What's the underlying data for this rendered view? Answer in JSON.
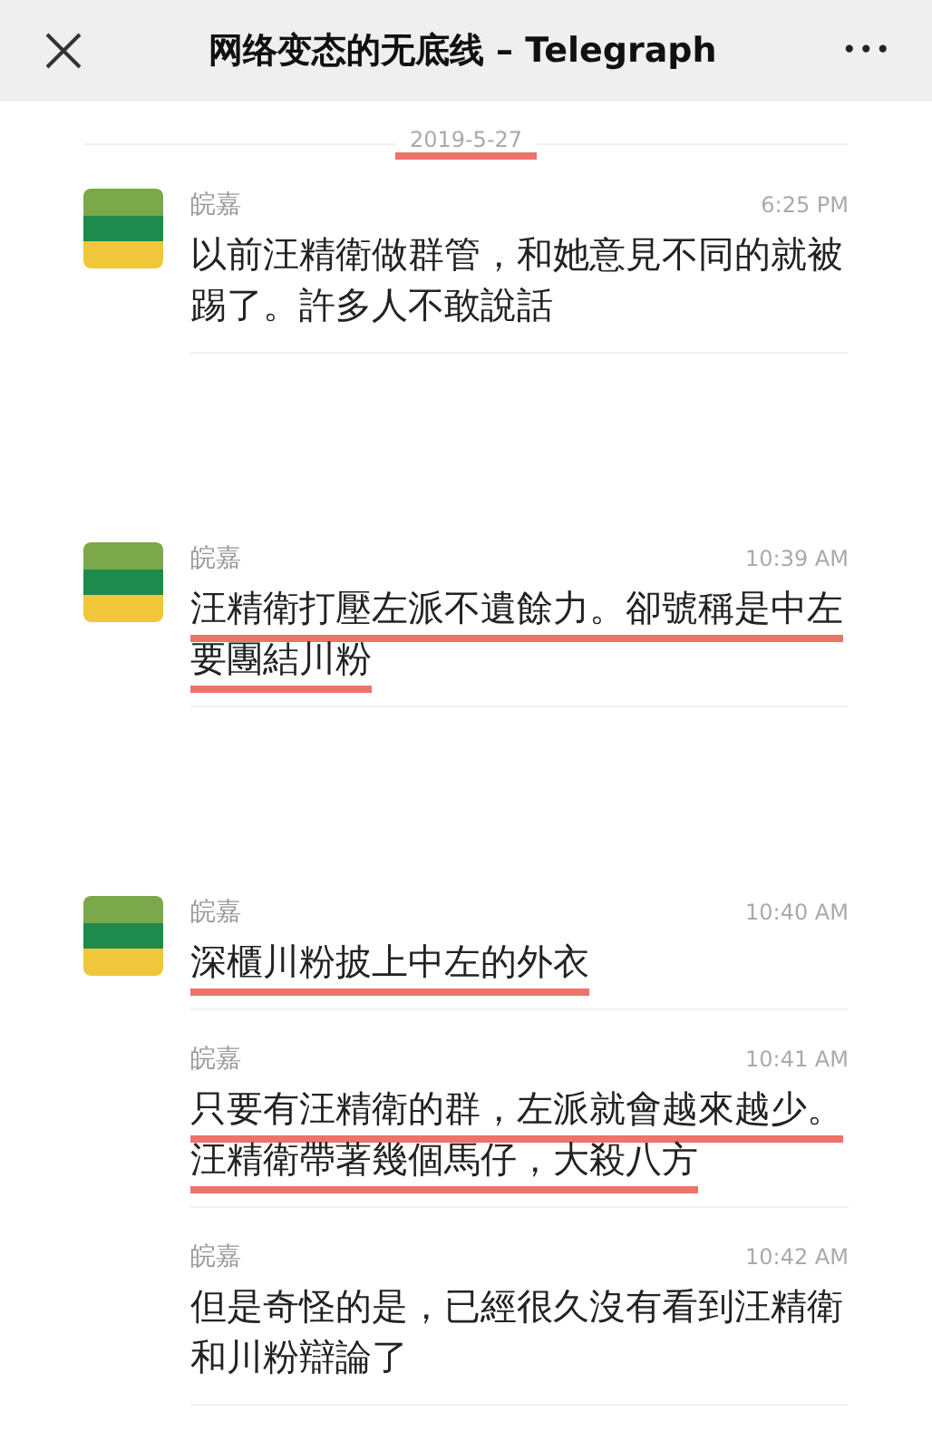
{
  "header": {
    "title": "网络变态的无底线 – Telegraph",
    "menu": "•••"
  },
  "date_separator": {
    "text": "2019-5-27",
    "underlined": true
  },
  "messages": [
    {
      "sender": "皖嘉",
      "time": "6:25 PM",
      "text": "以前汪精衛做群管，和她意見不同的就被踢了。許多人不敢說話",
      "show_avatar": true,
      "underlined": false
    },
    {
      "sender": "皖嘉",
      "time": "10:39 AM",
      "text": "汪精衛打壓左派不遺餘力。卻號稱是中左要團結川粉",
      "show_avatar": true,
      "underlined": true
    },
    {
      "sender": "皖嘉",
      "time": "10:40 AM",
      "text": "深櫃川粉披上中左的外衣",
      "show_avatar": true,
      "underlined": true
    },
    {
      "sender": "皖嘉",
      "time": "10:41 AM",
      "text": "只要有汪精衛的群，左派就會越來越少。汪精衛帶著幾個馬仔，大殺八方",
      "show_avatar": false,
      "underlined": true
    },
    {
      "sender": "皖嘉",
      "time": "10:42 AM",
      "text": "但是奇怪的是，已經很久沒有看到汪精衛和川粉辯論了",
      "show_avatar": false,
      "underlined": false
    }
  ]
}
